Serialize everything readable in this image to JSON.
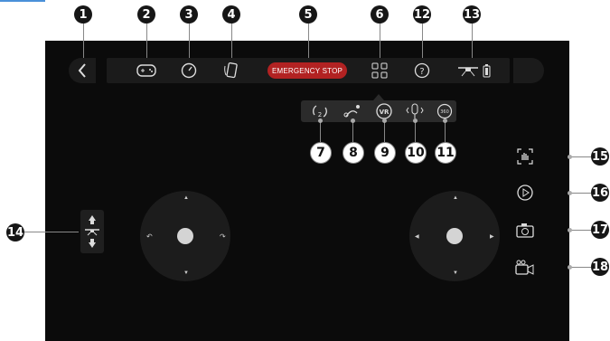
{
  "callouts": {
    "top": [
      "1",
      "2",
      "3",
      "4",
      "5",
      "6",
      "12",
      "13"
    ],
    "submenu": [
      "7",
      "8",
      "9",
      "10",
      "11"
    ],
    "left": [
      "14"
    ],
    "right": [
      "15",
      "16",
      "17",
      "18"
    ]
  },
  "topbar": {
    "back_icon": "chevron-left-icon",
    "controller_icon": "gamepad-icon",
    "speed_icon": "gauge-icon",
    "gravity_icon": "phone-tilt-icon",
    "emergency_stop": "EMERGENCY STOP",
    "menu_icon": "grid-icon",
    "help_icon": "help-icon",
    "drone_icon": "drone-battery-icon"
  },
  "submenu": {
    "items": [
      {
        "icon": "flip-icon",
        "text": "2"
      },
      {
        "icon": "trajectory-icon",
        "text": ""
      },
      {
        "icon": "vr-icon",
        "text": "VR"
      },
      {
        "icon": "gesture-icon",
        "text": ""
      },
      {
        "icon": "rotate-360-icon",
        "text": "360"
      }
    ]
  },
  "right_controls": [
    "gesture-photo-icon",
    "playback-icon",
    "camera-icon",
    "video-icon"
  ],
  "colors": {
    "emergency": "#b22222",
    "background": "#0b0b0b",
    "bar": "#1b1b1b"
  }
}
